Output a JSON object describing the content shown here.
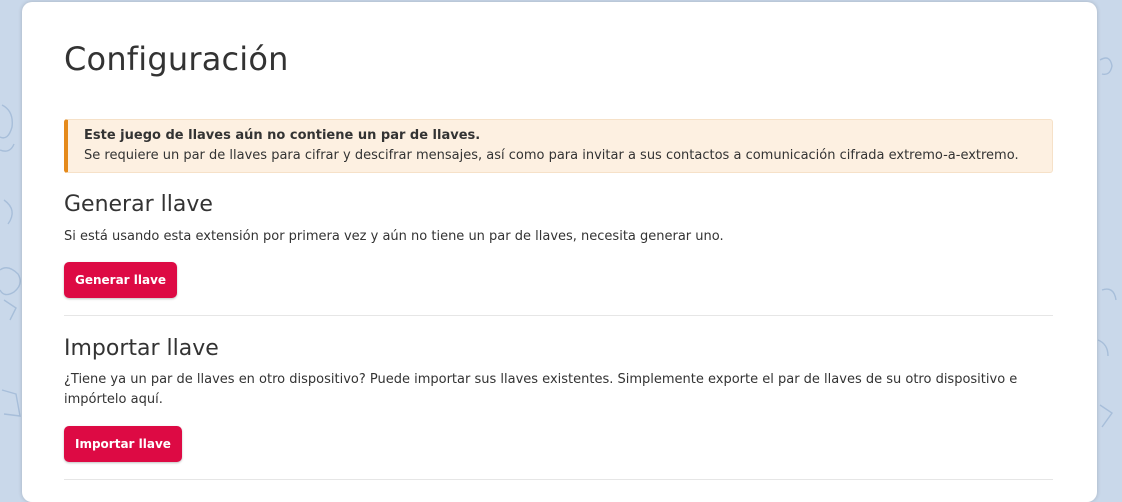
{
  "page": {
    "title": "Configuración"
  },
  "alert": {
    "title": "Este juego de llaves aún no contiene un par de llaves.",
    "text": "Se requiere un par de llaves para cifrar y descifrar mensajes, así como para invitar a sus contactos a comunicación cifrada extremo-a-extremo."
  },
  "generate": {
    "title": "Generar llave",
    "text": "Si está usando esta extensión por primera vez y aún no tiene un par de llaves, necesita generar uno.",
    "button_label": "Generar llave"
  },
  "import": {
    "title": "Importar llave",
    "text": "¿Tiene ya un par de llaves en otro dispositivo? Puede importar sus llaves existentes. Simplemente exporte el par de llaves de su otro dispositivo e impórtelo aquí.",
    "button_label": "Importar llave"
  },
  "colors": {
    "background": "#c9d8ea",
    "accent": "#dd0a44",
    "alert_bg": "#fdf0e1",
    "alert_border": "#e58a1b",
    "text": "#333333"
  }
}
